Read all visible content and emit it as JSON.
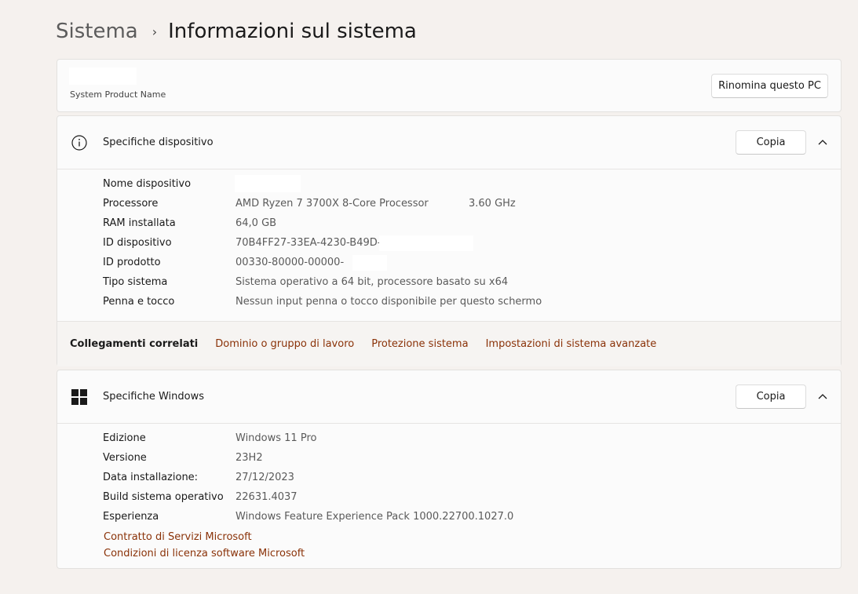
{
  "breadcrumb": {
    "parent": "Sistema",
    "separator": "›",
    "current": "Informazioni sul sistema"
  },
  "pc_card": {
    "product_name": "System Product Name",
    "rename_button": "Rinomina questo PC"
  },
  "device_specs": {
    "title": "Specifiche dispositivo",
    "copy_button": "Copia",
    "icon": "info-icon",
    "rows": [
      {
        "label": "Nome dispositivo",
        "value": ""
      },
      {
        "label": "Processore",
        "value": "AMD Ryzen 7 3700X 8-Core Processor",
        "extra": "3.60 GHz"
      },
      {
        "label": "RAM installata",
        "value": "64,0 GB"
      },
      {
        "label": "ID dispositivo",
        "value": "70B4FF27-33EA-4230-B49D-"
      },
      {
        "label": "ID prodotto",
        "value": "00330-80000-00000-"
      },
      {
        "label": "Tipo sistema",
        "value": "Sistema operativo a 64 bit, processore basato su x64"
      },
      {
        "label": "Penna e tocco",
        "value": "Nessun input penna o tocco disponibile per questo schermo"
      }
    ]
  },
  "related_links": {
    "title": "Collegamenti correlati",
    "links": [
      "Dominio o gruppo di lavoro",
      "Protezione sistema",
      "Impostazioni di sistema avanzate"
    ]
  },
  "windows_specs": {
    "title": "Specifiche Windows",
    "copy_button": "Copia",
    "icon": "windows-logo-icon",
    "rows": [
      {
        "label": "Edizione",
        "value": "Windows 11 Pro"
      },
      {
        "label": "Versione",
        "value": "23H2"
      },
      {
        "label": "Data installazione:",
        "value": "27/12/2023"
      },
      {
        "label": "Build sistema operativo",
        "value": "22631.4037"
      },
      {
        "label": "Esperienza",
        "value": "Windows Feature Experience Pack 1000.22700.1027.0"
      }
    ],
    "links": [
      "Contratto di Servizi Microsoft",
      "Condizioni di licenza software Microsoft"
    ]
  },
  "colors": {
    "accent_link": "#8a3208",
    "background": "#f5f1ee",
    "card": "#fbfbfb"
  }
}
